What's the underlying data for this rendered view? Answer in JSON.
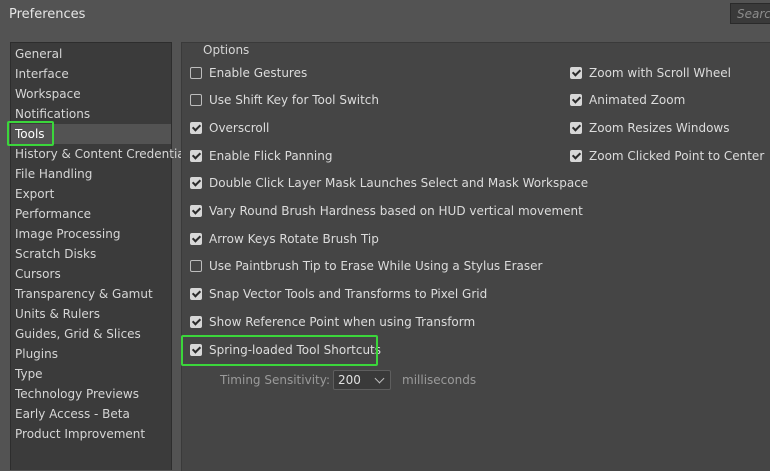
{
  "window": {
    "title": "Preferences",
    "search_placeholder": "Search"
  },
  "sidebar": {
    "items": [
      {
        "label": "General"
      },
      {
        "label": "Interface"
      },
      {
        "label": "Workspace"
      },
      {
        "label": "Notifications"
      },
      {
        "label": "Tools",
        "selected": true
      },
      {
        "label": "History & Content Credentials"
      },
      {
        "label": "File Handling"
      },
      {
        "label": "Export"
      },
      {
        "label": "Performance"
      },
      {
        "label": "Image Processing"
      },
      {
        "label": "Scratch Disks"
      },
      {
        "label": "Cursors"
      },
      {
        "label": "Transparency & Gamut"
      },
      {
        "label": "Units & Rulers"
      },
      {
        "label": "Guides, Grid & Slices"
      },
      {
        "label": "Plugins"
      },
      {
        "label": "Type"
      },
      {
        "label": "Technology Previews"
      },
      {
        "label": "Early Access - Beta"
      },
      {
        "label": "Product Improvement"
      }
    ]
  },
  "options": {
    "heading": "Options",
    "left": [
      {
        "label": "Enable Gestures",
        "checked": false
      },
      {
        "label": "Use Shift Key for Tool Switch",
        "checked": false
      },
      {
        "label": "Overscroll",
        "checked": true
      },
      {
        "label": "Enable Flick Panning",
        "checked": true
      },
      {
        "label": "Double Click Layer Mask Launches Select and Mask Workspace",
        "checked": true
      },
      {
        "label": "Vary Round Brush Hardness based on HUD vertical movement",
        "checked": true
      },
      {
        "label": "Arrow Keys Rotate Brush Tip",
        "checked": true
      },
      {
        "label": "Use Paintbrush Tip to Erase While Using a Stylus Eraser",
        "checked": false
      },
      {
        "label": "Snap Vector Tools and Transforms to Pixel Grid",
        "checked": true
      },
      {
        "label": "Show Reference Point when using Transform",
        "checked": true
      },
      {
        "label": "Spring-loaded Tool Shortcuts",
        "checked": true
      }
    ],
    "right": [
      {
        "label": "Zoom with Scroll Wheel",
        "checked": true
      },
      {
        "label": "Animated Zoom",
        "checked": true
      },
      {
        "label": "Zoom Resizes Windows",
        "checked": true
      },
      {
        "label": "Zoom Clicked Point to Center",
        "checked": true
      }
    ]
  },
  "timing": {
    "label": "Timing Sensitivity:",
    "value": "200",
    "unit": "milliseconds"
  },
  "colors": {
    "highlight": "#3bd63b",
    "panel_bg": "#454545",
    "sidebar_bg": "#3b3b3b"
  }
}
